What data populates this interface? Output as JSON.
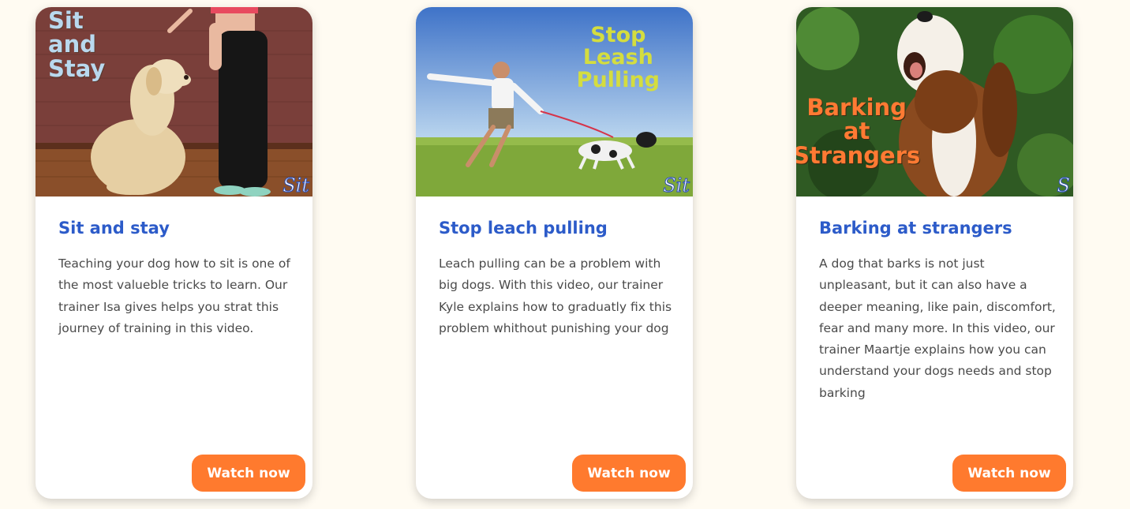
{
  "cards": [
    {
      "image_overlay": "Sit\nand\nStay",
      "watermark": "Sit",
      "title": "Sit and stay",
      "description": "Teaching your dog how to sit is one of the most valueble tricks to learn. Our trainer Isa gives helps you strat this journey of training in this video.",
      "button_label": "Watch now"
    },
    {
      "image_overlay": "Stop\nLeash\nPulling",
      "watermark": "Sit",
      "title": "Stop leach pulling",
      "description": "Leach pulling can be a problem with big dogs. With this video, our trainer Kyle explains how to graduatly fix this problem whithout punishing your dog",
      "button_label": "Watch now"
    },
    {
      "image_overlay": "Barking\nat\nStrangers",
      "watermark": "S",
      "title": "Barking at strangers",
      "description": "A dog that barks is not just unpleasant, but it can also have a deeper meaning, like pain, discomfort, fear and many more. In this video, our trainer Maartje explains how you can understand your dogs needs and stop barking",
      "button_label": "Watch now"
    }
  ],
  "colors": {
    "page_background": "#fffbf2",
    "title": "#2c5bc9",
    "text": "#4a4a4a",
    "button": "#ff7a2e"
  }
}
